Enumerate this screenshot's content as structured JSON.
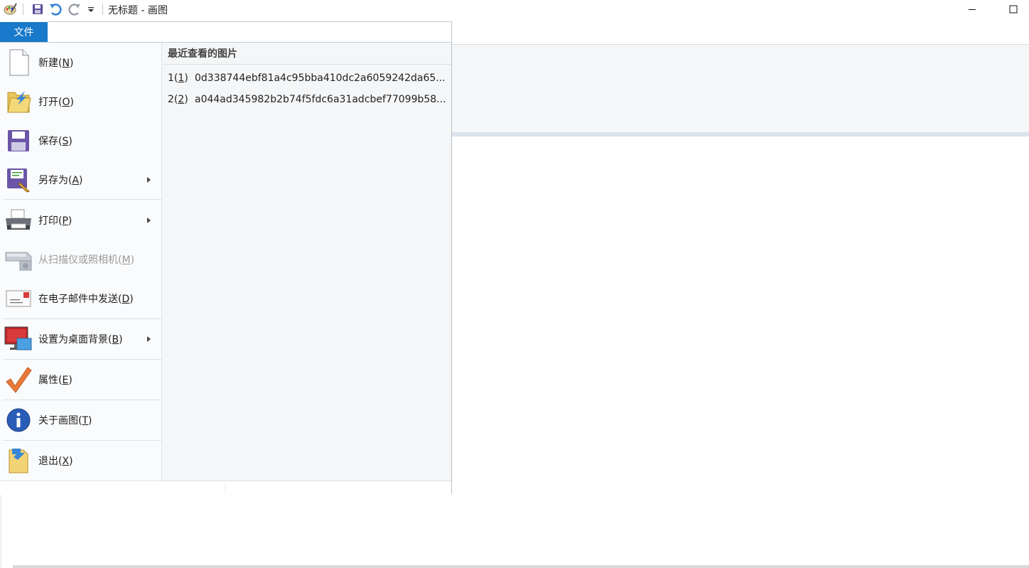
{
  "window": {
    "title": "无标题 - 画图",
    "minimize_icon": "minimize-icon",
    "maximize_icon": "maximize-icon"
  },
  "qat": {
    "app_icon": "paint-app-icon",
    "save_icon": "save-icon",
    "undo_icon": "undo-icon",
    "redo_icon": "redo-icon",
    "customize_icon": "dropdown-arrow-icon"
  },
  "file_tab": {
    "label": "文件"
  },
  "menu": {
    "items": [
      {
        "label": "新建",
        "key": "N",
        "icon": "new-document-icon",
        "submenu": false,
        "disabled": false
      },
      {
        "label": "打开",
        "key": "O",
        "icon": "open-folder-icon",
        "submenu": false,
        "disabled": false
      },
      {
        "label": "保存",
        "key": "S",
        "icon": "floppy-save-icon",
        "submenu": false,
        "disabled": false
      },
      {
        "label": "另存为",
        "key": "A",
        "icon": "save-as-icon",
        "submenu": true,
        "disabled": false
      },
      {
        "label": "打印",
        "key": "P",
        "icon": "printer-icon",
        "submenu": true,
        "disabled": false
      },
      {
        "label": "从扫描仪或照相机",
        "key": "M",
        "icon": "scanner-camera-icon",
        "submenu": false,
        "disabled": true
      },
      {
        "label": "在电子邮件中发送",
        "key": "D",
        "icon": "email-icon",
        "submenu": false,
        "disabled": false
      },
      {
        "label": "设置为桌面背景",
        "key": "B",
        "icon": "desktop-background-icon",
        "submenu": true,
        "disabled": false
      },
      {
        "label": "属性",
        "key": "E",
        "icon": "checkmark-icon",
        "submenu": false,
        "disabled": false
      },
      {
        "label": "关于画图",
        "key": "T",
        "icon": "info-icon",
        "submenu": false,
        "disabled": false
      },
      {
        "label": "退出",
        "key": "X",
        "icon": "exit-icon",
        "submenu": false,
        "disabled": false
      }
    ]
  },
  "recent": {
    "title": "最近查看的图片",
    "items": [
      {
        "index": "1",
        "key": "1",
        "name": "0d338744ebf81a4c95bba410dc2a6059242da65..."
      },
      {
        "index": "2",
        "key": "2",
        "name": "a044ad345982b2b74f5fdc6a31adcbef77099b58..."
      }
    ]
  },
  "colors": {
    "file_tab": "#1979ca",
    "menu_left_bg": "#fafbfc",
    "menu_right_bg": "#f5f6f7",
    "ribbon_bg": "#f5f6f7",
    "disabled_text": "#9a9a9a"
  }
}
